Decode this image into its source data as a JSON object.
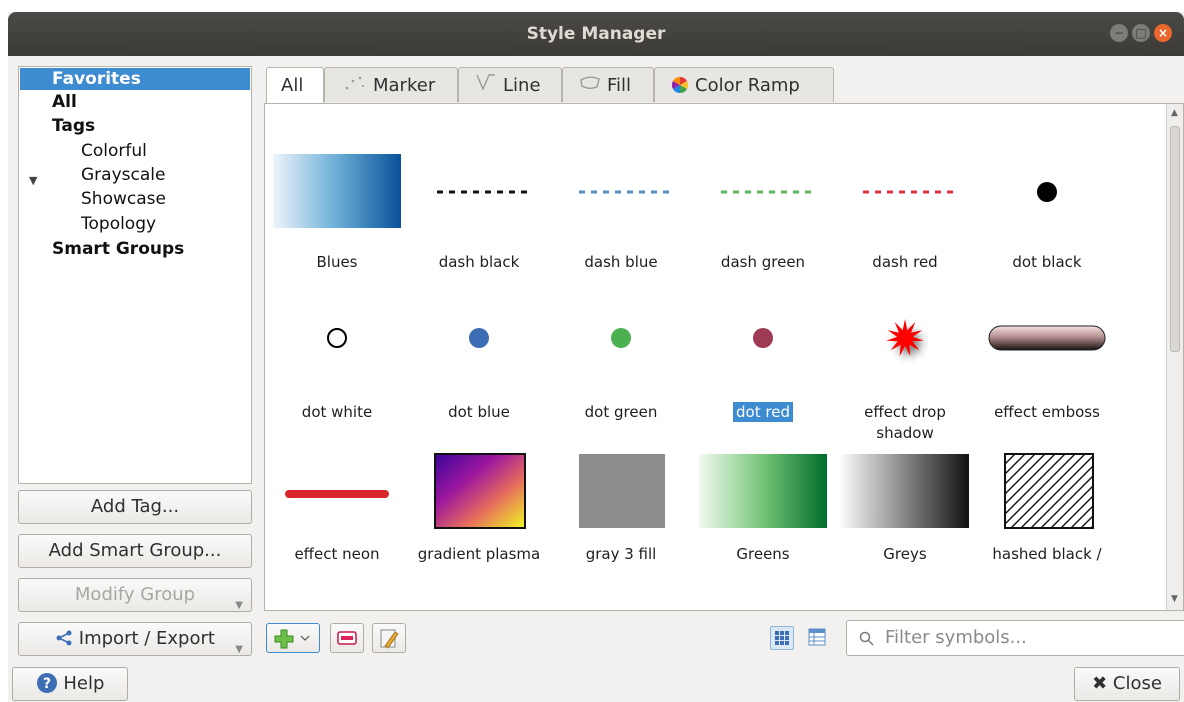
{
  "window": {
    "title": "Style Manager"
  },
  "sidebar": {
    "items": [
      {
        "label": "Favorites"
      },
      {
        "label": "All"
      },
      {
        "label": "Tags"
      },
      {
        "label": "Colorful"
      },
      {
        "label": "Grayscale"
      },
      {
        "label": "Showcase"
      },
      {
        "label": "Topology"
      },
      {
        "label": "Smart Groups"
      }
    ],
    "selected": "Favorites",
    "add_tag": "Add Tag...",
    "add_smart_group": "Add Smart Group...",
    "modify_group": "Modify Group",
    "import_export": "Import / Export"
  },
  "tabs": [
    {
      "label": "All",
      "icon": "none",
      "active": true
    },
    {
      "label": "Marker",
      "icon": "marker-icon"
    },
    {
      "label": "Line",
      "icon": "line-icon"
    },
    {
      "label": "Fill",
      "icon": "fill-icon"
    },
    {
      "label": "Color Ramp",
      "icon": "color-ramp-icon"
    }
  ],
  "symbols": [
    {
      "name": "Blues",
      "kind": "ramp-blues"
    },
    {
      "name": "dash  black",
      "kind": "dash",
      "color": "#111111"
    },
    {
      "name": "dash blue",
      "kind": "dash",
      "color": "#5b8fc9"
    },
    {
      "name": "dash green",
      "kind": "dash",
      "color": "#5cb85c"
    },
    {
      "name": "dash red",
      "kind": "dash",
      "color": "#e0323c"
    },
    {
      "name": "dot  black",
      "kind": "dot",
      "color": "#000000"
    },
    {
      "name": "dot  white",
      "kind": "dot-outline",
      "color": "#ffffff"
    },
    {
      "name": "dot blue",
      "kind": "dot",
      "color": "#3d6db5"
    },
    {
      "name": "dot green",
      "kind": "dot",
      "color": "#4caf50"
    },
    {
      "name": "dot red",
      "kind": "dot",
      "color": "#9e3a54",
      "selected": true
    },
    {
      "name": "effect drop shadow",
      "kind": "star",
      "color": "#ff0000"
    },
    {
      "name": "effect emboss",
      "kind": "emboss"
    },
    {
      "name": "effect neon",
      "kind": "neon",
      "color": "#d9262b"
    },
    {
      "name": "gradient plasma",
      "kind": "plasma"
    },
    {
      "name": "gray 3 fill",
      "kind": "square",
      "color": "#8c8c8c"
    },
    {
      "name": "Greens",
      "kind": "ramp-greens"
    },
    {
      "name": "Greys",
      "kind": "ramp-greys"
    },
    {
      "name": "hashed black /",
      "kind": "hatch"
    }
  ],
  "toolbar": {
    "add_icon": "add-symbol-icon",
    "remove_icon": "remove-symbol-icon",
    "edit_icon": "edit-symbol-icon",
    "icon_view": "icon-view-icon",
    "list_view": "list-view-icon"
  },
  "filter": {
    "placeholder": "Filter symbols..."
  },
  "footer": {
    "help": "Help",
    "close": "Close"
  }
}
